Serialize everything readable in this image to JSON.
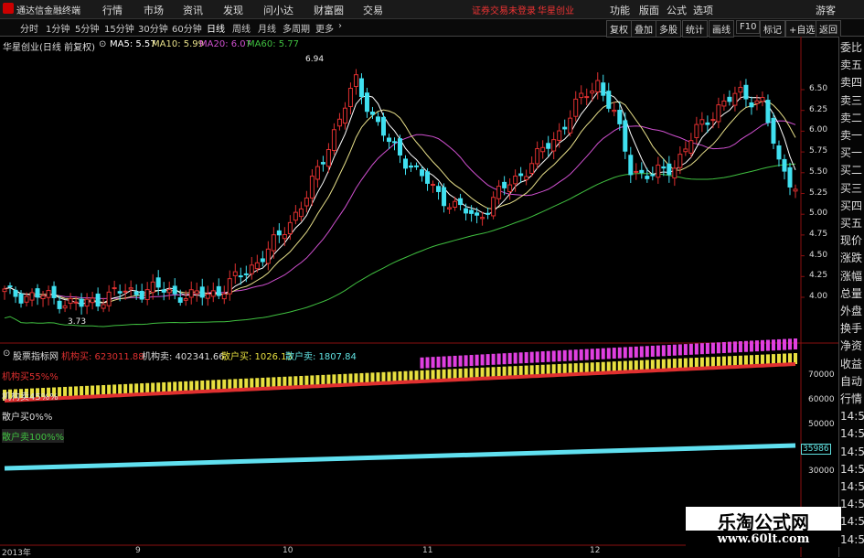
{
  "titlebar": {
    "app_name": "通达信金融终端",
    "menus": [
      "行情",
      "市场",
      "资讯",
      "发现",
      "问小达",
      "财富圈",
      "交易"
    ],
    "warning": "证券交易未登录",
    "stock": "华星创业",
    "right_menus": [
      "功能",
      "版面",
      "公式",
      "选项"
    ],
    "user": "游客"
  },
  "toolbar": {
    "periods": [
      "分时",
      "1分钟",
      "5分钟",
      "15分钟",
      "30分钟",
      "60分钟",
      "日线",
      "周线",
      "月线",
      "多周期",
      "更多"
    ],
    "active_period": "日线",
    "right_buttons": [
      "复权",
      "叠加",
      "多股",
      "统计",
      "画线",
      "F10",
      "标记",
      "+自选",
      "返回"
    ]
  },
  "main_chart": {
    "stock_label": "华星创业(日线 前复权)",
    "ma": [
      {
        "label": "MA5: 5.57",
        "color": "#ffffff"
      },
      {
        "label": "MA10: 5.99",
        "color": "#e8e08a"
      },
      {
        "label": "MA20: 6.07",
        "color": "#d050d0"
      },
      {
        "label": "MA60: 5.77",
        "color": "#40c040"
      }
    ],
    "y_ticks": [
      "6.50",
      "6.25",
      "6.00",
      "5.75",
      "5.50",
      "5.25",
      "5.00",
      "4.75",
      "4.50",
      "4.25",
      "4.00"
    ],
    "high_label": "6.94",
    "low_label": "3.73"
  },
  "indicator": {
    "name": "股票指标网",
    "values": [
      {
        "label": "机构买: 623011.88",
        "color": "#e03030"
      },
      {
        "label": "机构卖: 402341.66",
        "color": "#dddddd"
      },
      {
        "label": "散户买: 1026.13",
        "color": "#e8e040"
      },
      {
        "label": "散户卖: 1807.84",
        "color": "#60e0e0"
      }
    ],
    "side_labels": [
      {
        "text": "机构买55%%",
        "color": "#e03030"
      },
      {
        "text": "机构卖45%%",
        "color": "#dddddd"
      },
      {
        "text": "散户买0%%",
        "color": "#dddddd"
      },
      {
        "text": "散户卖100%%",
        "color": "#40c040"
      }
    ],
    "y_ticks": [
      "70000",
      "60000",
      "50000",
      "40000",
      "30000"
    ],
    "current_value": "35986"
  },
  "right_panel": {
    "items": [
      "委比",
      "卖五",
      "卖四",
      "卖三",
      "卖二",
      "卖一",
      "买一",
      "买二",
      "买三",
      "买四",
      "买五",
      "现价",
      "涨跌",
      "涨幅",
      "总量",
      "外盘",
      "换手",
      "净资",
      "收益",
      "自动",
      "行情",
      "14:5",
      "14:5",
      "14:5",
      "14:5",
      "14:5",
      "14:5",
      "14:5",
      "14:5"
    ]
  },
  "dates": [
    "2013年",
    "9",
    "10",
    "11",
    "12"
  ],
  "watermark": {
    "title": "乐淘公式网",
    "url": "www.60lt.com"
  },
  "colors": {
    "up": "#e03030",
    "down": "#40e0f0",
    "background": "#000000"
  }
}
